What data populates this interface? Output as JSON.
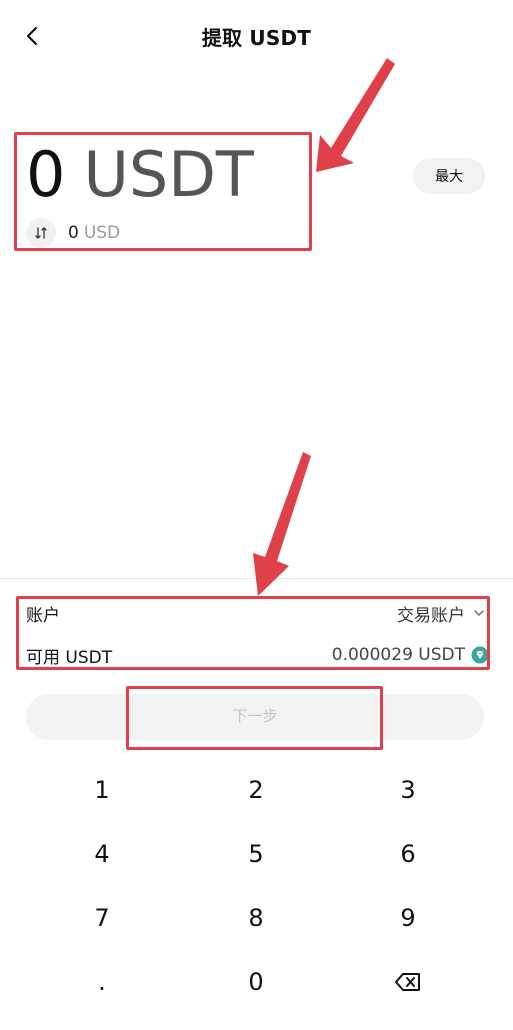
{
  "header": {
    "title": "提取 USDT"
  },
  "amount": {
    "value": "0",
    "currency": "USDT"
  },
  "converted": {
    "value": "0",
    "unit": "USD"
  },
  "max_label": "最大",
  "account": {
    "label": "账户",
    "selected": "交易账户"
  },
  "available": {
    "label": "可用 USDT",
    "value": "0.000029 USDT"
  },
  "next_label": "下一步",
  "keypad": {
    "k1": "1",
    "k2": "2",
    "k3": "3",
    "k4": "4",
    "k5": "5",
    "k6": "6",
    "k7": "7",
    "k8": "8",
    "k9": "9",
    "dot": ".",
    "k0": "0"
  },
  "colors": {
    "annotation": "#e0404a",
    "gem": "#3aa6a0"
  }
}
